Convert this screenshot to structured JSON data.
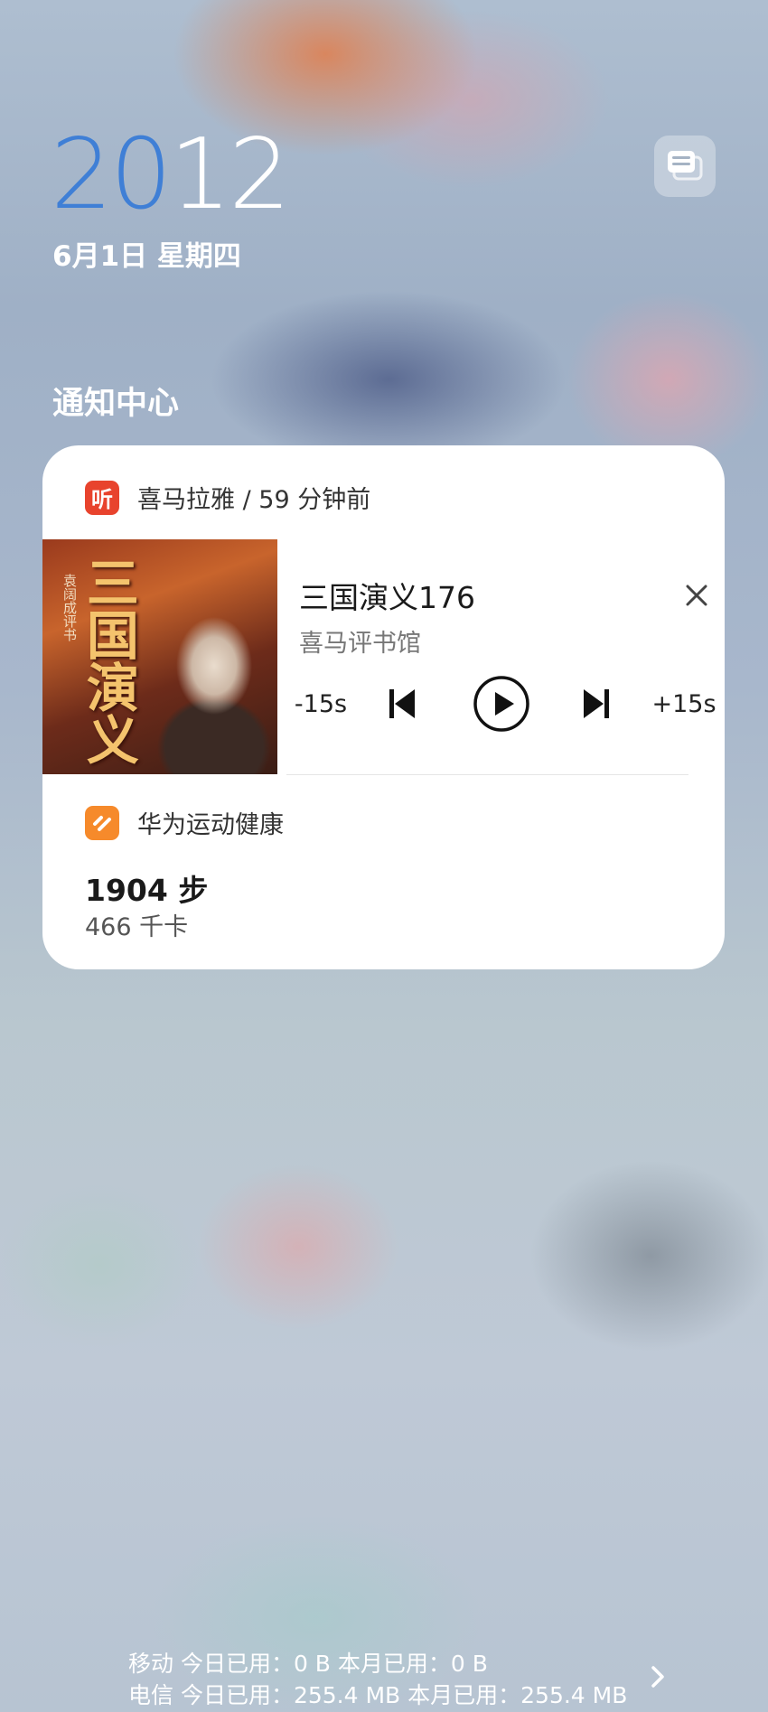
{
  "lockscreen": {
    "clock_hours": "20",
    "clock_minutes": "12",
    "date": "6月1日 星期四"
  },
  "notification_center": {
    "title": "通知中心"
  },
  "media_notification": {
    "app_name": "喜马拉雅 / 59 分钟前",
    "app_icon_glyph": "听",
    "app_icon_color": "#e8432d",
    "cover_title": "三国演义",
    "cover_subtitle": "袁阔成评书",
    "track_title": "三国演义176",
    "artist": "喜马评书馆",
    "rewind_label": "-15s",
    "forward_label": "+15s",
    "icons": [
      "close-icon",
      "previous-icon",
      "play-icon",
      "next-icon"
    ]
  },
  "health_notification": {
    "app_name": "华为运动健康",
    "app_icon_color": "#f68a2b",
    "steps": "1904 步",
    "calories": "466 千卡"
  },
  "data_usage": {
    "line1": "移动 今日已用：0 B 本月已用：0 B",
    "line2": "电信 今日已用：255.4 MB 本月已用：255.4 MB"
  }
}
